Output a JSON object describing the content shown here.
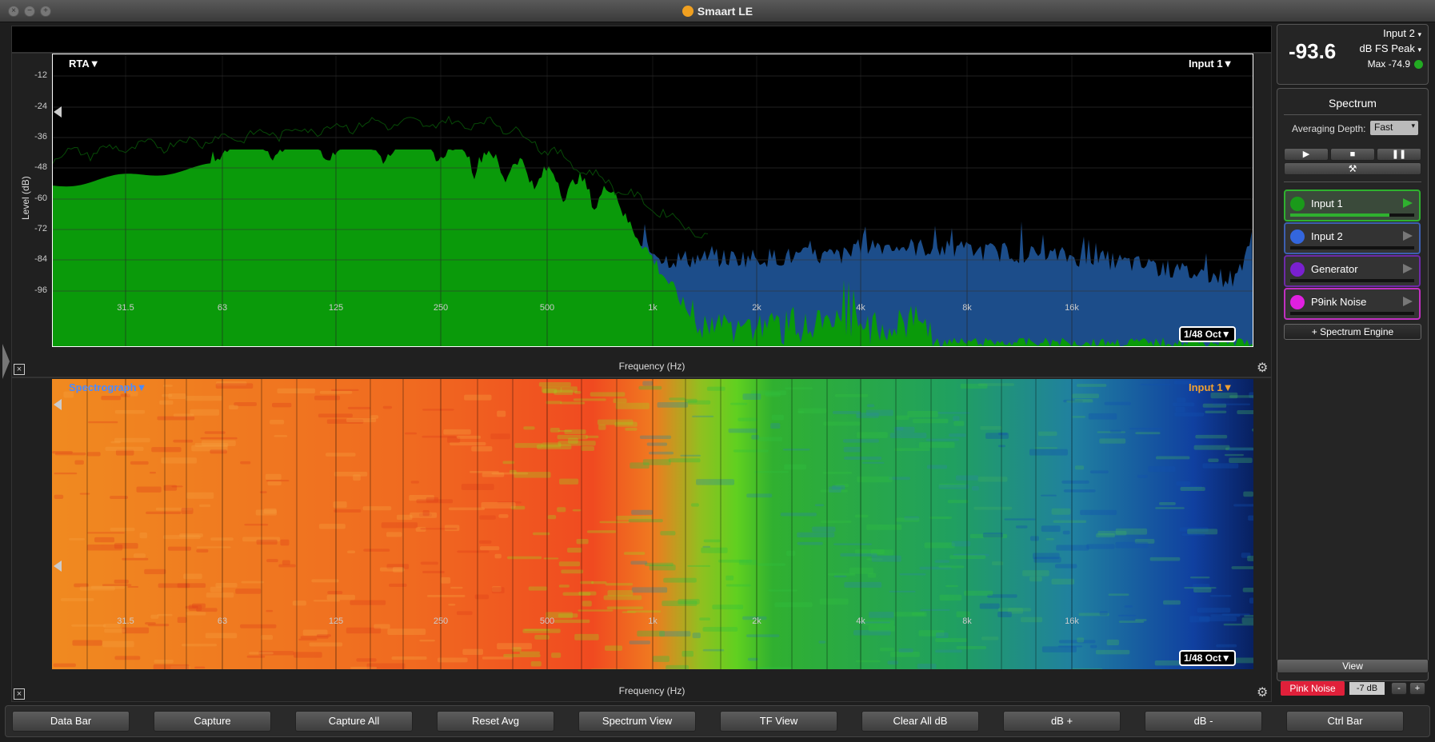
{
  "window": {
    "title": "Smaart LE"
  },
  "rta": {
    "mode_label": "RTA▼",
    "input_label": "Input 1▼",
    "resolution": "1/48 Oct▼",
    "y_title": "Level (dB)",
    "x_title": "Frequency (Hz)",
    "y_ticks": [
      "-12",
      "-24",
      "-36",
      "-48",
      "-60",
      "-72",
      "-84",
      "-96"
    ],
    "x_ticks": [
      "31.5",
      "63",
      "125",
      "250",
      "500",
      "1k",
      "2k",
      "4k",
      "8k",
      "16k"
    ],
    "colors": {
      "input1": "#0a9a0a",
      "input2": "#1c4d8a",
      "background": "#000000"
    }
  },
  "spectrograph": {
    "mode_label": "Spectrograph▼",
    "input_label": "Input 1▼",
    "resolution": "1/48 Oct▼",
    "x_title": "Frequency (Hz)",
    "x_ticks": [
      "31.5",
      "63",
      "125",
      "250",
      "500",
      "1k",
      "2k",
      "4k",
      "8k",
      "16k"
    ]
  },
  "level_meter": {
    "value": "-93.6",
    "input": "Input 2",
    "unit": "dB FS Peak",
    "max": "Max -74.9",
    "status_color": "#22aa22"
  },
  "spectrum_panel": {
    "title": "Spectrum",
    "averaging_label": "Averaging Depth:",
    "averaging_value": "Fast",
    "add_engine": "+ Spectrum Engine",
    "engines": [
      {
        "label": "Input 1",
        "color": "#1a9a1a",
        "border": "#2fb12f",
        "active": true
      },
      {
        "label": "Input 2",
        "color": "#3366dd",
        "border": "#3d5fb0",
        "active": false
      },
      {
        "label": "Generator",
        "color": "#7a20d0",
        "border": "#6e2aa8",
        "active": false
      },
      {
        "label": "P9ink Noise",
        "color": "#e020e0",
        "border": "#c030c0",
        "active": false
      }
    ]
  },
  "view_panel": {
    "view_label": "View",
    "generator_label": "Pink Noise",
    "generator_level": "-7 dB",
    "minus": "-",
    "plus": "+"
  },
  "bottom_bar": {
    "buttons": [
      "Data Bar",
      "Capture",
      "Capture All",
      "Reset Avg",
      "Spectrum View",
      "TF View",
      "Clear All dB",
      "dB +",
      "dB -",
      "Ctrl Bar"
    ]
  }
}
